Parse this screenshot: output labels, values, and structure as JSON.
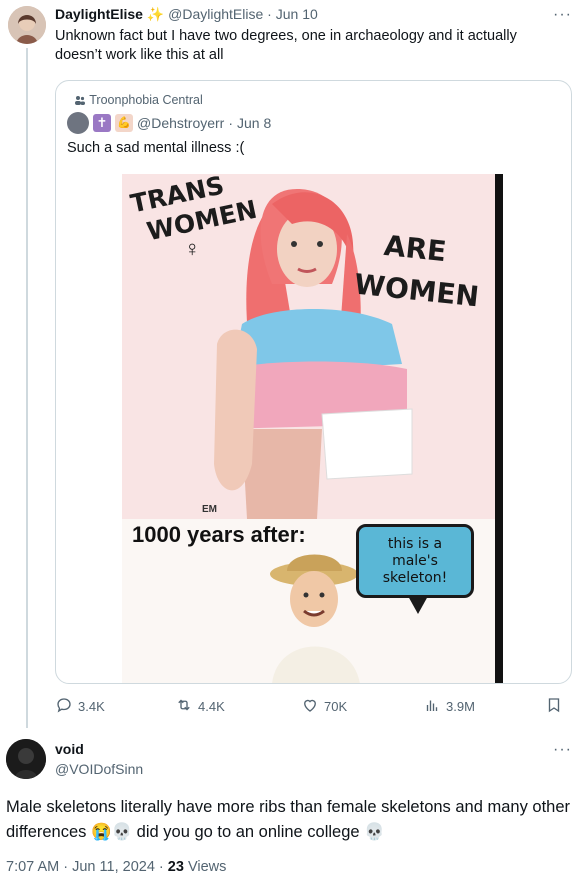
{
  "tweet1": {
    "display_name": "DaylightElise",
    "emoji": "✨",
    "handle": "@DaylightElise",
    "date": "Jun 10",
    "text": "Unknown fact but I have two degrees, one  in archaeology and it actually doesn’t work like this at all",
    "more": "···"
  },
  "quote": {
    "community": "Troonphobia Central",
    "handle": "@Dehstroyerr",
    "date": "Jun 8",
    "text": "Such a sad mental illness :(",
    "badges": [
      "✝",
      "💪"
    ],
    "image": {
      "word_trans": "TRANS",
      "word_women_left": "WOMEN",
      "word_are": "ARE",
      "word_women_right": "WOMEN",
      "venus": "♀",
      "signature": "EM",
      "caption": "1000 years after:",
      "bubble_text": "this is a\nmale's\nskeleton!"
    }
  },
  "actions": {
    "replies": "3.4K",
    "reposts": "4.4K",
    "likes": "70K",
    "views": "3.9M"
  },
  "tweet2": {
    "display_name": "void",
    "handle": "@VOIDofSinn",
    "more": "···",
    "text": "Male skeletons literally have more ribs than female skeletons and many other differences 😭💀 did you go to an online college 💀",
    "time": "7:07 AM",
    "date": "Jun 11, 2024",
    "views_count": "23",
    "views_label": "Views"
  }
}
